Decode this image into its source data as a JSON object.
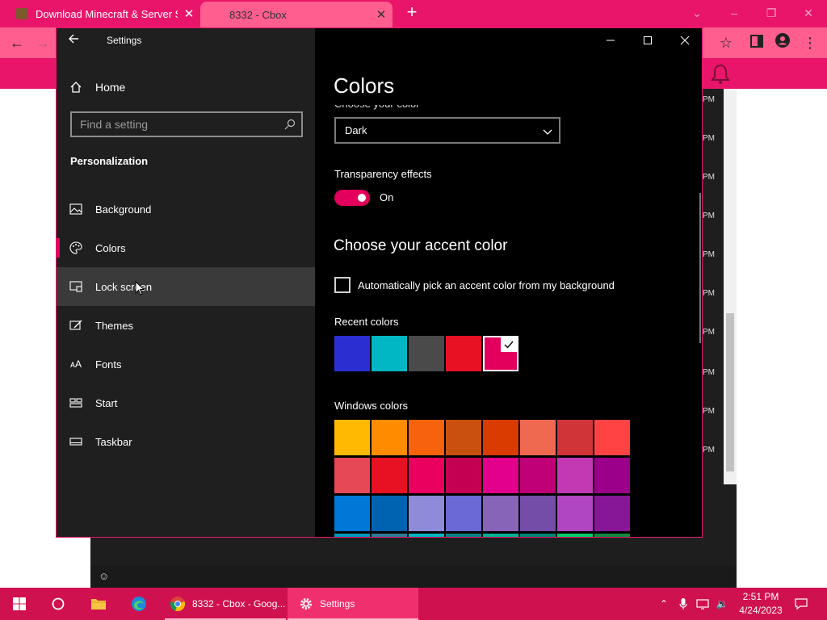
{
  "browser": {
    "tabs": [
      {
        "title": "Download Minecraft & Server So",
        "close": "✕"
      },
      {
        "title": "8332 - Cbox",
        "close": "✕"
      }
    ],
    "new_tab": "+"
  },
  "page": {
    "chat_times": [
      "PM",
      "PM",
      "PM",
      "PM",
      "PM",
      "PM",
      "PM",
      "PM",
      "PM",
      "PM"
    ]
  },
  "settings": {
    "window_title": "Settings",
    "home_label": "Home",
    "search_placeholder": "Find a setting",
    "section_title": "Personalization",
    "nav": [
      {
        "label": "Background",
        "icon": "picture-icon"
      },
      {
        "label": "Colors",
        "icon": "palette-icon",
        "selected": true
      },
      {
        "label": "Lock screen",
        "icon": "lock-screen-icon",
        "hover": true
      },
      {
        "label": "Themes",
        "icon": "themes-icon"
      },
      {
        "label": "Fonts",
        "icon": "fonts-icon"
      },
      {
        "label": "Start",
        "icon": "start-icon"
      },
      {
        "label": "Taskbar",
        "icon": "taskbar-icon"
      }
    ],
    "page_title": "Colors",
    "choose_color_label": "Choose your color",
    "choose_color_value": "Dark",
    "transparency_label": "Transparency effects",
    "transparency_state": "On",
    "accent_heading": "Choose your accent color",
    "auto_pick_label": "Automatically pick an accent color from my background",
    "recent_label": "Recent colors",
    "recent_colors": [
      "#2b2ed0",
      "#00b7c3",
      "#4a4a4a",
      "#e81123",
      "#e3005c"
    ],
    "selected_recent_index": 4,
    "windows_colors_label": "Windows colors",
    "windows_colors": [
      [
        "#ffb900",
        "#ff8c00",
        "#f7630c",
        "#ca5010",
        "#da3b01",
        "#ef6950",
        "#d13438",
        "#ff4343"
      ],
      [
        "#e74856",
        "#e81123",
        "#ea005e",
        "#c30052",
        "#e3008c",
        "#bf0077",
        "#c239b3",
        "#9a0089"
      ],
      [
        "#0078d7",
        "#0063b1",
        "#8e8cd8",
        "#6b69d6",
        "#8764b8",
        "#744da9",
        "#b146c2",
        "#881798"
      ],
      [
        "#0099bc",
        "#2d7d9a",
        "#00b7c3",
        "#038387",
        "#00b294",
        "#018574",
        "#00cc6a",
        "#10893e"
      ]
    ],
    "accent_color": "#e3005c"
  },
  "taskbar": {
    "chrome_label": "8332 - Cbox - Goog...",
    "settings_label": "Settings",
    "time": "2:51 PM",
    "date": "4/24/2023"
  }
}
